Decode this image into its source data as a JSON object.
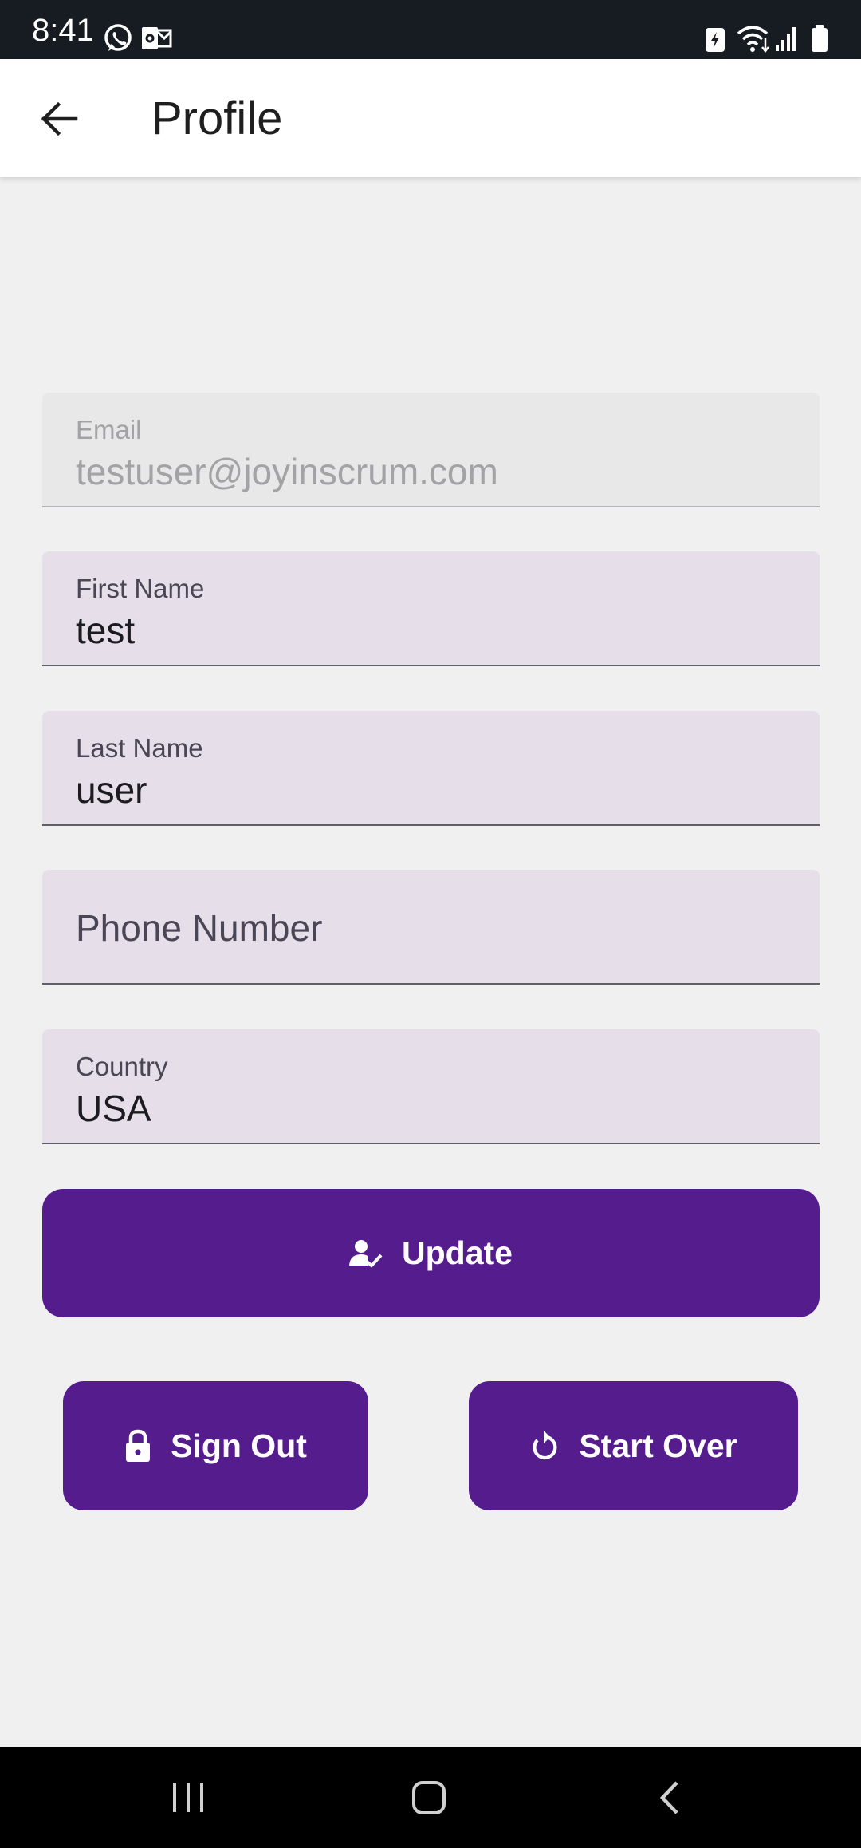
{
  "status_bar": {
    "time": "8:41",
    "icons": [
      "whatsapp-icon",
      "outlook-icon",
      "battery-saver-icon",
      "wifi-icon",
      "cell-signal-icon",
      "battery-icon"
    ]
  },
  "app_bar": {
    "title": "Profile",
    "back_icon": "arrow-left-icon"
  },
  "form": {
    "email": {
      "label": "Email",
      "value": "testuser@joyinscrum.com",
      "disabled": true
    },
    "first_name": {
      "label": "First Name",
      "value": "test"
    },
    "last_name": {
      "label": "Last Name",
      "value": "user"
    },
    "phone": {
      "placeholder": "Phone Number",
      "value": ""
    },
    "country": {
      "label": "Country",
      "value": "USA"
    }
  },
  "buttons": {
    "update": {
      "label": "Update",
      "icon": "user-check-icon"
    },
    "sign_out": {
      "label": "Sign Out",
      "icon": "lock-icon"
    },
    "start_over": {
      "label": "Start Over",
      "icon": "refresh-icon"
    }
  },
  "nav_bar": {
    "icons": [
      "recent-apps-icon",
      "home-icon",
      "back-icon"
    ]
  },
  "colors": {
    "primary": "#541c8c",
    "field_bg": "#e6dfea",
    "page_bg": "#f0f0f0",
    "status_bar_bg": "#171b22"
  }
}
